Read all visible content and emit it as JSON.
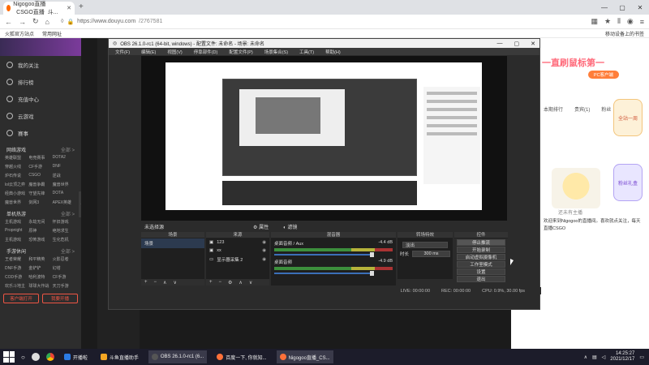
{
  "browser": {
    "tab_title": "Nigogoo直播_CSGO直播_斗...",
    "url_host": "https://www.douyu.com",
    "url_path": "/2767581",
    "bookmarks": [
      "火狐官方站点",
      "常用网址"
    ],
    "bookmarks_right": "移动设备上的书签"
  },
  "sidebar": {
    "items": [
      "我的关注",
      "排行榜",
      "充值中心",
      "云游戏",
      "赛事"
    ],
    "sections": [
      {
        "title": "网络游戏",
        "more": "全部 >",
        "items": [
          "英雄联盟",
          "电竞赛事",
          "DOTA2",
          "穿越火线",
          "CF手游",
          "DNF",
          "炉石传说",
          "CSGO",
          "逆战",
          "lol云顶之弈",
          "魔兽争霸",
          "魔兽世界",
          "经典小游戏",
          "守望先锋",
          "DOTA",
          "魔兽世界",
          "剑网3",
          "APEX英雄"
        ]
      },
      {
        "title": "单机热游",
        "more": "全部 >",
        "items": [
          "主机游戏",
          "永劫无间",
          "怀旧游戏",
          "Propnight",
          "原神",
          "绝地求生",
          "主机游戏",
          "恐怖游戏",
          "生化危机"
        ]
      },
      {
        "title": "手游休闲",
        "more": "全部 >",
        "items": [
          "王者荣耀",
          "和平精英",
          "火影忍者",
          "DNF手游",
          "金铲铲",
          "幻塔",
          "COD手游",
          "哈利波特",
          "CF手游",
          "欢乐斗地主",
          "球球大作战",
          "天刀手游"
        ]
      }
    ],
    "buttons": [
      "客户端打开",
      "我要开播"
    ]
  },
  "page_right": {
    "pc_btn": "PC客户端",
    "tabs": [
      "本期排行",
      "贵宾(1)",
      "粉丝"
    ],
    "badge1": "全站一周",
    "badge2": "粉丝礼盒",
    "caption": "还未有主播",
    "intro": "欢迎来到Nigogoo的直播间。喜欢就点关注，每天直播CSGO"
  },
  "obs": {
    "title": "OBS 26.1.0-rc1 (64-bit, windows) - 配置文件: 未命名 - 场景: 未命名",
    "menu": [
      "文件(F)",
      "编辑(E)",
      "视图(V)",
      "停靠部件(D)",
      "配置文件(P)",
      "场景集合(S)",
      "工具(T)",
      "帮助(H)"
    ],
    "scenebar": {
      "label": "未选择源",
      "prop": "属性",
      "filter": "滤镜"
    },
    "docks": {
      "scenes": {
        "title": "场景",
        "items": [
          "场景"
        ]
      },
      "sources": {
        "title": "来源",
        "items": [
          "123",
          "xx",
          "显示器采集 2"
        ]
      },
      "mixer": {
        "title": "混音器",
        "tracks": [
          {
            "name": "桌面音频 / Aux",
            "db": "-4.4 dB"
          },
          {
            "name": "桌面音频",
            "db": "-4.9 dB"
          }
        ]
      },
      "transitions": {
        "title": "转场特效",
        "type": "淡出",
        "duration_label": "时长",
        "duration": "300 ms"
      },
      "controls": {
        "title": "控件",
        "buttons": [
          "停止推流",
          "开始录制",
          "启动虚拟摄像机",
          "工作室模式",
          "设置",
          "退出"
        ]
      }
    },
    "status": {
      "live": "LIVE: 00:00:00",
      "rec": "REC: 00:00:00",
      "cpu": "CPU: 0.9%, 30.00 fps"
    }
  },
  "taskbar": {
    "tasks": [
      "开播啦",
      "斗鱼直播助手",
      "OBS 26.1.0-rc1 (6...",
      "百度一下, 你就知...",
      "Nigogoo直播_CS..."
    ],
    "time": "14:25:27",
    "date": "2021/12/17"
  }
}
